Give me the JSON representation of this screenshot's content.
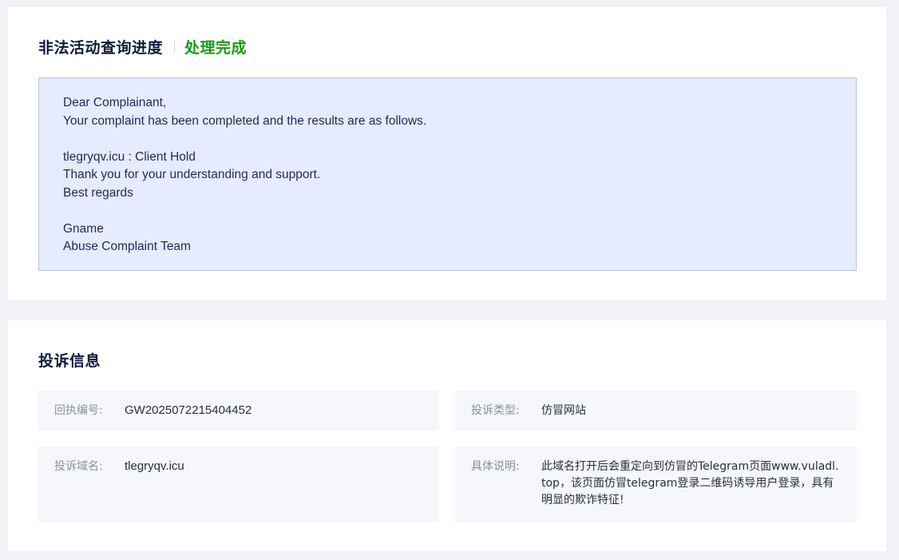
{
  "progress": {
    "title": "非法活动查询进度",
    "status": "处理完成",
    "status_color": "#1a9b12",
    "message_lines": [
      "Dear Complainant,",
      "Your complaint has been completed and the results are as follows.",
      "",
      "tlegryqv.icu : Client Hold",
      "Thank you for your understanding and support.",
      "Best regards",
      "",
      "Gname",
      "Abuse Complaint Team"
    ]
  },
  "info": {
    "title": "投诉信息",
    "receipt_no": {
      "label": "回执编号:",
      "value": "GW2025072215404452"
    },
    "complaint_type": {
      "label": "投诉类型:",
      "value": "仿冒网站"
    },
    "domain": {
      "label": "投诉域名:",
      "value": "tlegryqv.icu"
    },
    "description": {
      "label": "具体说明:",
      "value": "此域名打开后会重定向到仿冒的Telegram页面www.vuladl.top，该页面仿冒telegram登录二维码诱导用户登录，具有明显的欺诈特征!"
    }
  }
}
